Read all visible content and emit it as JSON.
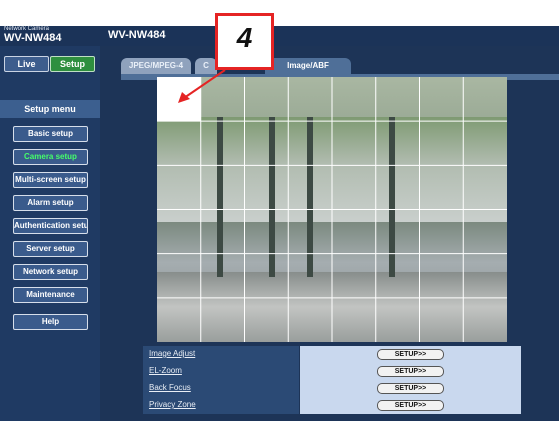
{
  "header": {
    "brand_sub": "Network Camera",
    "brand_model": "WV-NW484",
    "page_title": "WV-NW484"
  },
  "sidebar": {
    "live_label": "Live",
    "setup_label": "Setup",
    "menu_title": "Setup menu",
    "items": [
      {
        "label": "Basic setup",
        "active": false
      },
      {
        "label": "Camera setup",
        "active": true
      },
      {
        "label": "Multi-screen setup",
        "active": false
      },
      {
        "label": "Alarm setup",
        "active": false
      },
      {
        "label": "Authentication setup",
        "active": false
      },
      {
        "label": "Server setup",
        "active": false
      },
      {
        "label": "Network setup",
        "active": false
      },
      {
        "label": "Maintenance",
        "active": false
      },
      {
        "label": "Help",
        "active": false
      }
    ]
  },
  "tabs": [
    {
      "label": "JPEG/MPEG-4"
    },
    {
      "label": "C"
    },
    {
      "label": "Image/ABF"
    }
  ],
  "callout": {
    "number": "4"
  },
  "settings_rows": [
    {
      "label": "Image Adjust",
      "button": "SETUP>>"
    },
    {
      "label": "EL-Zoom",
      "button": "SETUP>>"
    },
    {
      "label": "Back Focus",
      "button": "SETUP>>"
    },
    {
      "label": "Privacy Zone",
      "button": "SETUP>>"
    }
  ],
  "colors": {
    "active_menu_text": "#45ff6a",
    "setup_button_bg": "#2e8f3f",
    "callout_border": "#e52424"
  }
}
